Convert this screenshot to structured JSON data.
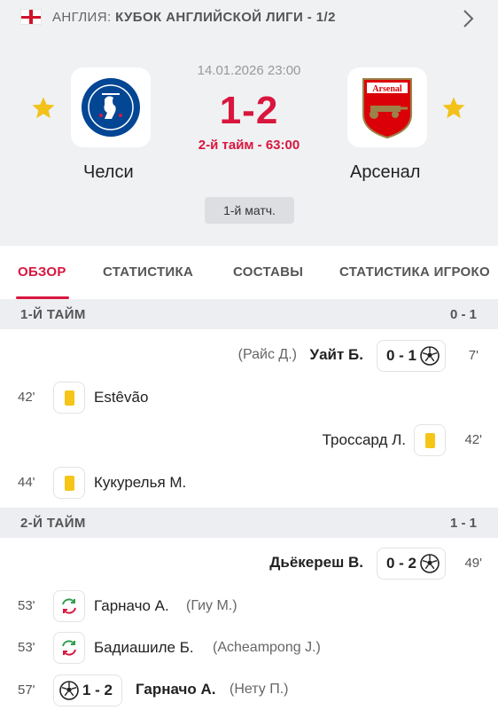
{
  "topbar": {
    "country": "АНГЛИЯ:",
    "competition": "КУБОК АНГЛИЙСКОЙ ЛИГИ - 1/2"
  },
  "match": {
    "datetime": "14.01.2026 23:00",
    "score": "1-2",
    "status": "2-й тайм - 63:00",
    "leg": "1-й матч.",
    "home": {
      "name": "Челси"
    },
    "away": {
      "name": "Арсенал"
    }
  },
  "colors": {
    "accent": "#d8163e",
    "yellow_card": "#f5c518",
    "star": "#f2c21b"
  },
  "tabs": [
    {
      "label": "ОБЗОР",
      "active": true
    },
    {
      "label": "СТАТИСТИКА"
    },
    {
      "label": "СОСТАВЫ"
    },
    {
      "label": "СТАТИСТИКА ИГРОКО"
    }
  ],
  "sections": {
    "first_half": {
      "title": "1-Й ТАЙМ",
      "score": "0 - 1"
    },
    "second_half": {
      "title": "2-Й ТАЙМ",
      "score": "1 - 1"
    }
  },
  "events": {
    "e1": {
      "minute": "7'",
      "player": "Уайт Б.",
      "assist": "(Райс Д.)",
      "score": "0 - 1",
      "icon": "ball-icon"
    },
    "e2": {
      "minute": "42'",
      "player": "Estêvão",
      "icon": "yellow-card-icon"
    },
    "e3": {
      "minute": "42'",
      "player": "Троссард Л.",
      "icon": "yellow-card-icon"
    },
    "e4": {
      "minute": "44'",
      "player": "Кукурелья М.",
      "icon": "yellow-card-icon"
    },
    "e5": {
      "minute": "49'",
      "player": "Дьёкереш В.",
      "score": "0 - 2",
      "icon": "ball-icon"
    },
    "e6": {
      "minute": "53'",
      "player": "Гарначо А.",
      "assist": "(Гиу М.)",
      "icon": "substitution-icon"
    },
    "e7": {
      "minute": "53'",
      "player": "Бадиашиле Б.",
      "assist": "(Acheampong J.)",
      "icon": "substitution-icon"
    },
    "e8": {
      "minute": "57'",
      "player": "Гарначо А.",
      "assist": "(Нету П.)",
      "score": "1 - 2",
      "icon": "ball-icon"
    }
  }
}
